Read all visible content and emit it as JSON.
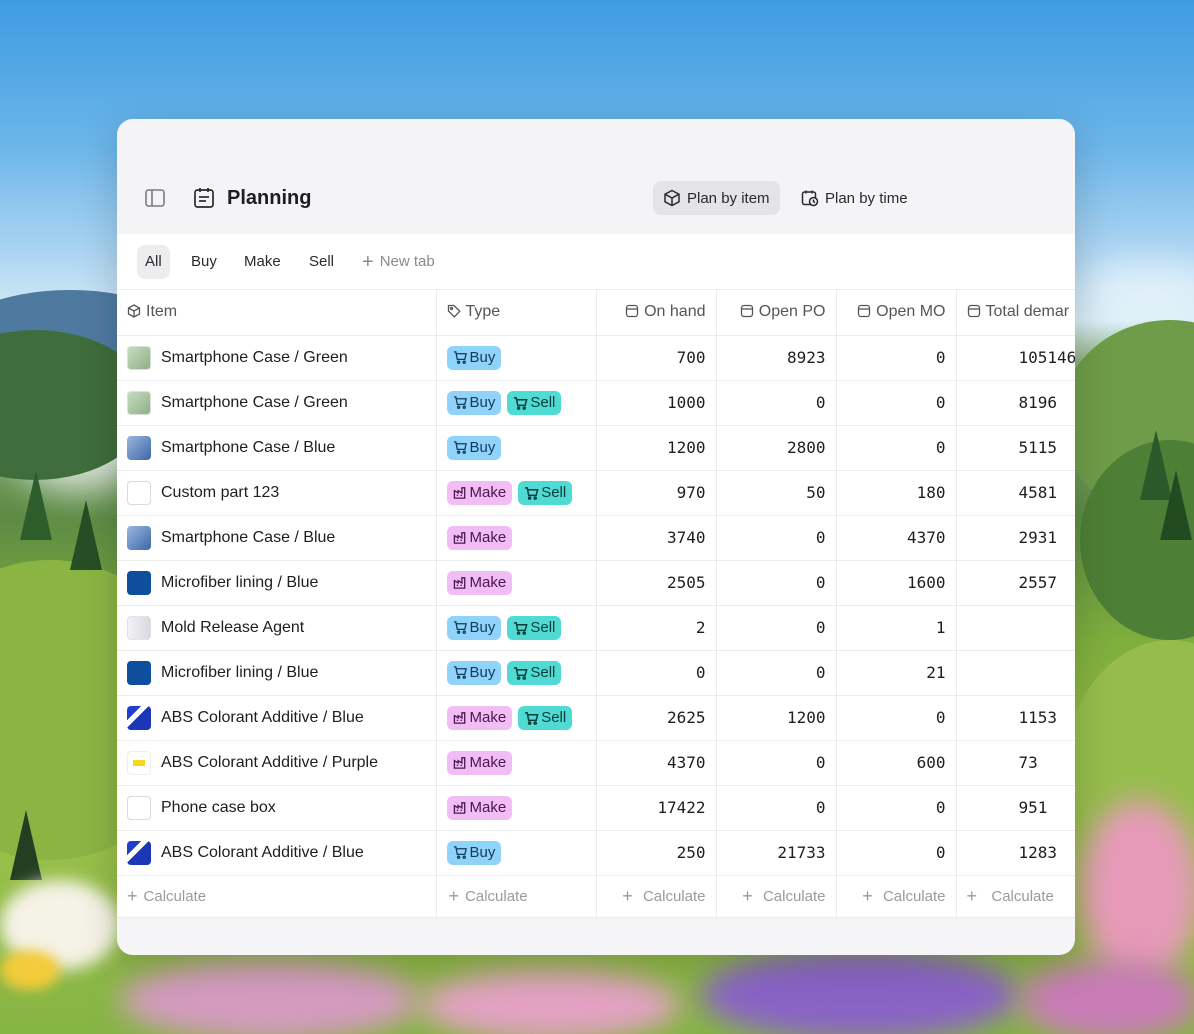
{
  "colors": {
    "buy_badge": "#8fd3fb",
    "make_badge": "#f2bcf5",
    "sell_badge": "#4fdbd4",
    "window_bg": "#f5f4f6"
  },
  "header": {
    "title": "Planning",
    "plan_by_item": "Plan by item",
    "plan_by_time": "Plan by time"
  },
  "tabs": [
    "All",
    "Buy",
    "Make",
    "Sell"
  ],
  "new_tab": "New tab",
  "columns": [
    "Item",
    "Type",
    "On hand",
    "Open PO",
    "Open MO",
    "Total demar"
  ],
  "rows": [
    {
      "item": "Smartphone Case / Green",
      "thumb": "green",
      "types": [
        "Buy"
      ],
      "on_hand": "700",
      "open_po": "8923",
      "open_mo": "0",
      "total": "105146"
    },
    {
      "item": "Smartphone Case / Green",
      "thumb": "green",
      "types": [
        "Buy",
        "Sell"
      ],
      "on_hand": "1000",
      "open_po": "0",
      "open_mo": "0",
      "total": "8196"
    },
    {
      "item": "Smartphone Case / Blue",
      "thumb": "blue-case",
      "types": [
        "Buy"
      ],
      "on_hand": "1200",
      "open_po": "2800",
      "open_mo": "0",
      "total": "5115"
    },
    {
      "item": "Custom part 123",
      "thumb": "cube",
      "types": [
        "Make",
        "Sell"
      ],
      "on_hand": "970",
      "open_po": "50",
      "open_mo": "180",
      "total": "4581"
    },
    {
      "item": "Smartphone Case / Blue",
      "thumb": "blue-case",
      "types": [
        "Make"
      ],
      "on_hand": "3740",
      "open_po": "0",
      "open_mo": "4370",
      "total": "2931"
    },
    {
      "item": "Microfiber lining / Blue",
      "thumb": "navy",
      "types": [
        "Make"
      ],
      "on_hand": "2505",
      "open_po": "0",
      "open_mo": "1600",
      "total": "2557"
    },
    {
      "item": "Mold Release Agent",
      "thumb": "bottle",
      "types": [
        "Buy",
        "Sell"
      ],
      "on_hand": "2",
      "open_po": "0",
      "open_mo": "1",
      "total": ""
    },
    {
      "item": "Microfiber lining / Blue",
      "thumb": "navy",
      "types": [
        "Buy",
        "Sell"
      ],
      "on_hand": "0",
      "open_po": "0",
      "open_mo": "21",
      "total": ""
    },
    {
      "item": "ABS Colorant Additive / Blue",
      "thumb": "abs-blue",
      "types": [
        "Make",
        "Sell"
      ],
      "on_hand": "2625",
      "open_po": "1200",
      "open_mo": "0",
      "total": "1153"
    },
    {
      "item": "ABS Colorant Additive / Purple",
      "thumb": "abs-yellow",
      "types": [
        "Make"
      ],
      "on_hand": "4370",
      "open_po": "0",
      "open_mo": "600",
      "total": "73"
    },
    {
      "item": "Phone case box",
      "thumb": "box",
      "types": [
        "Make"
      ],
      "on_hand": "17422",
      "open_po": "0",
      "open_mo": "0",
      "total": "951"
    },
    {
      "item": "ABS Colorant Additive / Blue",
      "thumb": "abs-blue",
      "types": [
        "Buy"
      ],
      "on_hand": "250",
      "open_po": "21733",
      "open_mo": "0",
      "total": "1283"
    }
  ],
  "calculate_label": "Calculate"
}
